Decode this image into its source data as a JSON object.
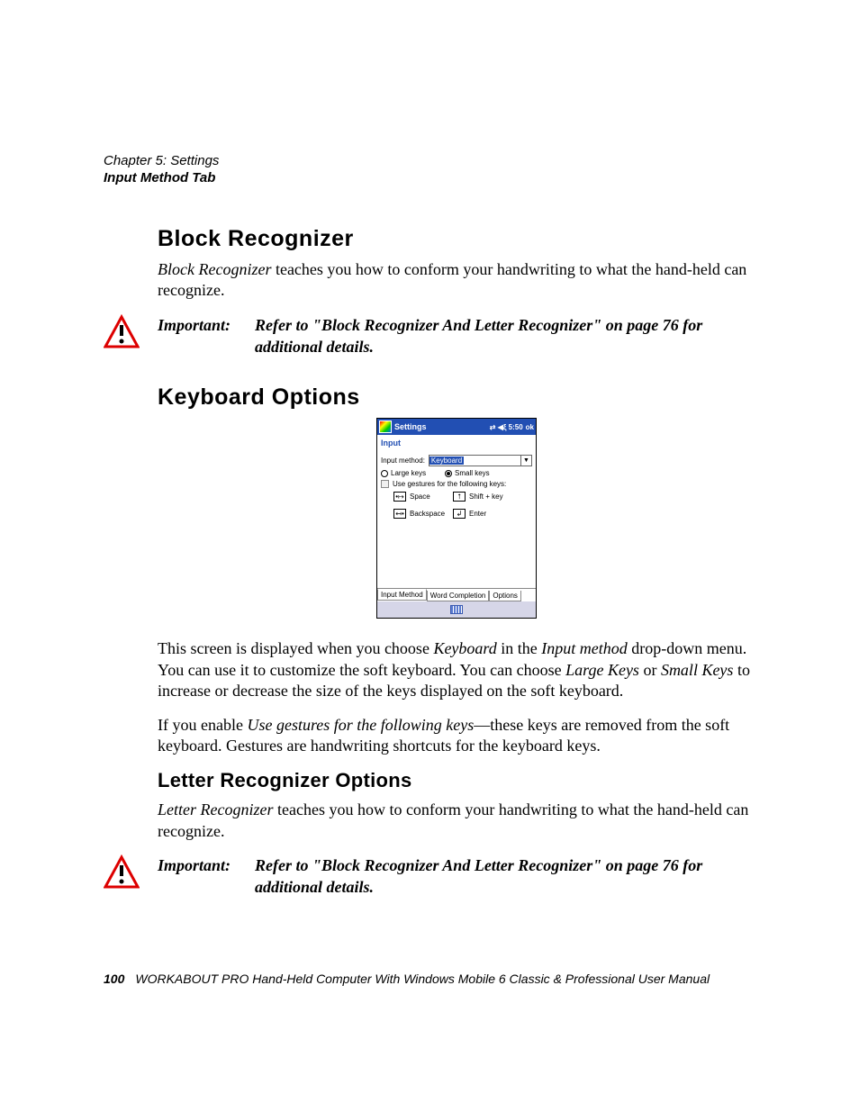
{
  "header": {
    "chapter": "Chapter 5: Settings",
    "section": "Input Method Tab"
  },
  "sections": {
    "block_recognizer": {
      "title": "Block Recognizer",
      "p1_em": "Block Recognizer",
      "p1_rest": " teaches you how to conform your handwriting to what the hand-held can recognize.",
      "important_label": "Important:",
      "important_text": "Refer to \"Block Recognizer And Letter Recognizer\" on page 76 for additional details."
    },
    "keyboard_options": {
      "title": "Keyboard Options",
      "p1_a": "This screen is displayed when you choose ",
      "p1_em1": "Keyboard",
      "p1_b": " in the ",
      "p1_em2": "Input method",
      "p1_c": " drop-down menu. You can use it to customize the soft keyboard. You can choose ",
      "p1_em3": "Large Keys",
      "p1_d": " or ",
      "p1_em4": "Small Keys",
      "p1_e": " to increase or decrease the size of the keys displayed on the soft keyboard.",
      "p2_a": "If you enable ",
      "p2_em1": "Use gestures for the following keys",
      "p2_b": "—these keys are removed from the soft keyboard. Gestures are handwriting shortcuts for the keyboard keys."
    },
    "letter_recognizer": {
      "title": "Letter Recognizer Options",
      "p1_em": "Letter Recognizer",
      "p1_rest": " teaches you how to conform your handwriting to what the hand-held can recognize.",
      "important_label": "Important:",
      "important_text": "Refer to \"Block Recognizer And Letter Recognizer\" on page 76 for additional details."
    }
  },
  "screenshot": {
    "title": "Settings",
    "status_time": "5:50",
    "ok": "ok",
    "subtitle": "Input",
    "input_method_label": "Input method:",
    "dropdown_value": "Keyboard",
    "radio_large": "Large keys",
    "radio_small": "Small keys",
    "checkbox_label": "Use gestures for the following keys:",
    "gesture_space": "Space",
    "gesture_shift": "Shift + key",
    "gesture_backspace": "Backspace",
    "gesture_enter": "Enter",
    "tabs": [
      "Input Method",
      "Word Completion",
      "Options"
    ]
  },
  "footer": {
    "page": "100",
    "text": "WORKABOUT PRO Hand-Held Computer With Windows Mobile 6 Classic & Professional User Manual"
  }
}
